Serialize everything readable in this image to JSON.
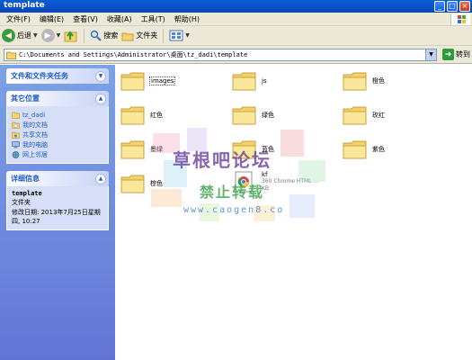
{
  "window": {
    "title": "template"
  },
  "menu": [
    "文件(F)",
    "编辑(E)",
    "查看(V)",
    "收藏(A)",
    "工具(T)",
    "帮助(H)"
  ],
  "toolbar": {
    "back_label": "后退",
    "search_label": "搜索",
    "folders_label": "文件夹"
  },
  "address": {
    "path": "C:\\Documents and Settings\\Administrator\\桌面\\tz_dadi\\template",
    "go_label": "转到"
  },
  "tasks_panel": {
    "title": "文件和文件夹任务"
  },
  "places_panel": {
    "title": "其它位置",
    "items": [
      {
        "label": "tz_dadi",
        "icon": "folder-icon"
      },
      {
        "label": "我的文档",
        "icon": "documents-icon"
      },
      {
        "label": "共享文档",
        "icon": "shared-documents-icon"
      },
      {
        "label": "我的电脑",
        "icon": "computer-icon"
      },
      {
        "label": "网上邻居",
        "icon": "network-icon"
      }
    ]
  },
  "details_panel": {
    "title": "详细信息",
    "name": "template",
    "type": "文件夹",
    "modified": "修改日期: 2013年7月25日星期四, 10:27"
  },
  "files": [
    {
      "name": "images",
      "type": "folder"
    },
    {
      "name": "js",
      "type": "folder"
    },
    {
      "name": "橙色",
      "type": "folder"
    },
    {
      "name": "红色",
      "type": "folder"
    },
    {
      "name": "绿色",
      "type": "folder"
    },
    {
      "name": "玫红",
      "type": "folder"
    },
    {
      "name": "墨绿",
      "type": "folder"
    },
    {
      "name": "蓝色",
      "type": "folder"
    },
    {
      "name": "紫色",
      "type": "folder"
    },
    {
      "name": "棕色",
      "type": "folder"
    },
    {
      "name": "kf",
      "type": "file",
      "subtitle": "360 Chrome HTML ...",
      "size": "KB"
    }
  ],
  "watermark": {
    "line1": "草根吧论坛",
    "line2": "禁止转载",
    "line3": "www.caogen8.co"
  }
}
